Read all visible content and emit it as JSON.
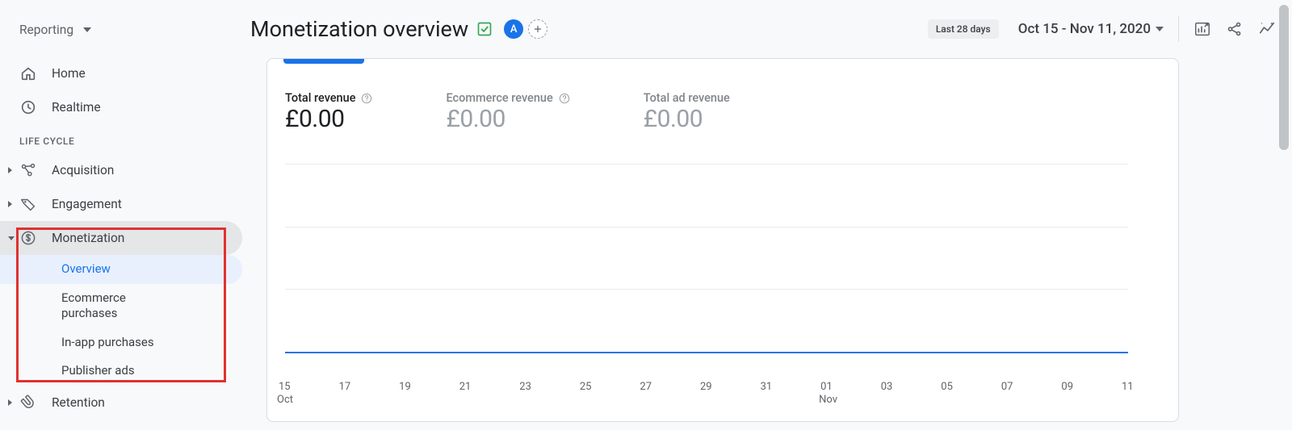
{
  "sidebar": {
    "reporting_label": "Reporting",
    "home_label": "Home",
    "realtime_label": "Realtime",
    "section_label": "LIFE CYCLE",
    "acquisition_label": "Acquisition",
    "engagement_label": "Engagement",
    "monetization_label": "Monetization",
    "monetization_sub": {
      "overview": "Overview",
      "ecommerce": "Ecommerce purchases",
      "inapp": "In-app purchases",
      "publisher": "Publisher ads"
    },
    "retention_label": "Retention"
  },
  "header": {
    "title": "Monetization overview",
    "badge_letter": "A",
    "date_chip": "Last 28 days",
    "date_range": "Oct 15 - Nov 11, 2020"
  },
  "stats": {
    "total_revenue_label": "Total revenue",
    "total_revenue_value": "£0.00",
    "ecommerce_revenue_label": "Ecommerce revenue",
    "ecommerce_revenue_value": "£0.00",
    "total_ad_revenue_label": "Total ad revenue",
    "total_ad_revenue_value": "£0.00"
  },
  "chart_data": {
    "type": "line",
    "title": "",
    "xlabel": "",
    "ylabel": "",
    "ylim": [
      0,
      0
    ],
    "series": [
      {
        "name": "Total revenue",
        "values": [
          0,
          0,
          0,
          0,
          0,
          0,
          0,
          0,
          0,
          0,
          0,
          0,
          0,
          0,
          0,
          0,
          0,
          0,
          0,
          0,
          0,
          0,
          0,
          0,
          0,
          0,
          0,
          0
        ]
      }
    ],
    "categories": [
      "15",
      "16",
      "17",
      "18",
      "19",
      "20",
      "21",
      "22",
      "23",
      "24",
      "25",
      "26",
      "27",
      "28",
      "29",
      "30",
      "31",
      "01",
      "02",
      "03",
      "04",
      "05",
      "06",
      "07",
      "08",
      "09",
      "10",
      "11"
    ],
    "x_tick_labels": [
      "15",
      "17",
      "19",
      "21",
      "23",
      "25",
      "27",
      "29",
      "31",
      "01",
      "03",
      "05",
      "07",
      "09",
      "11"
    ],
    "x_month_labels": {
      "15": "Oct",
      "01": "Nov"
    }
  }
}
